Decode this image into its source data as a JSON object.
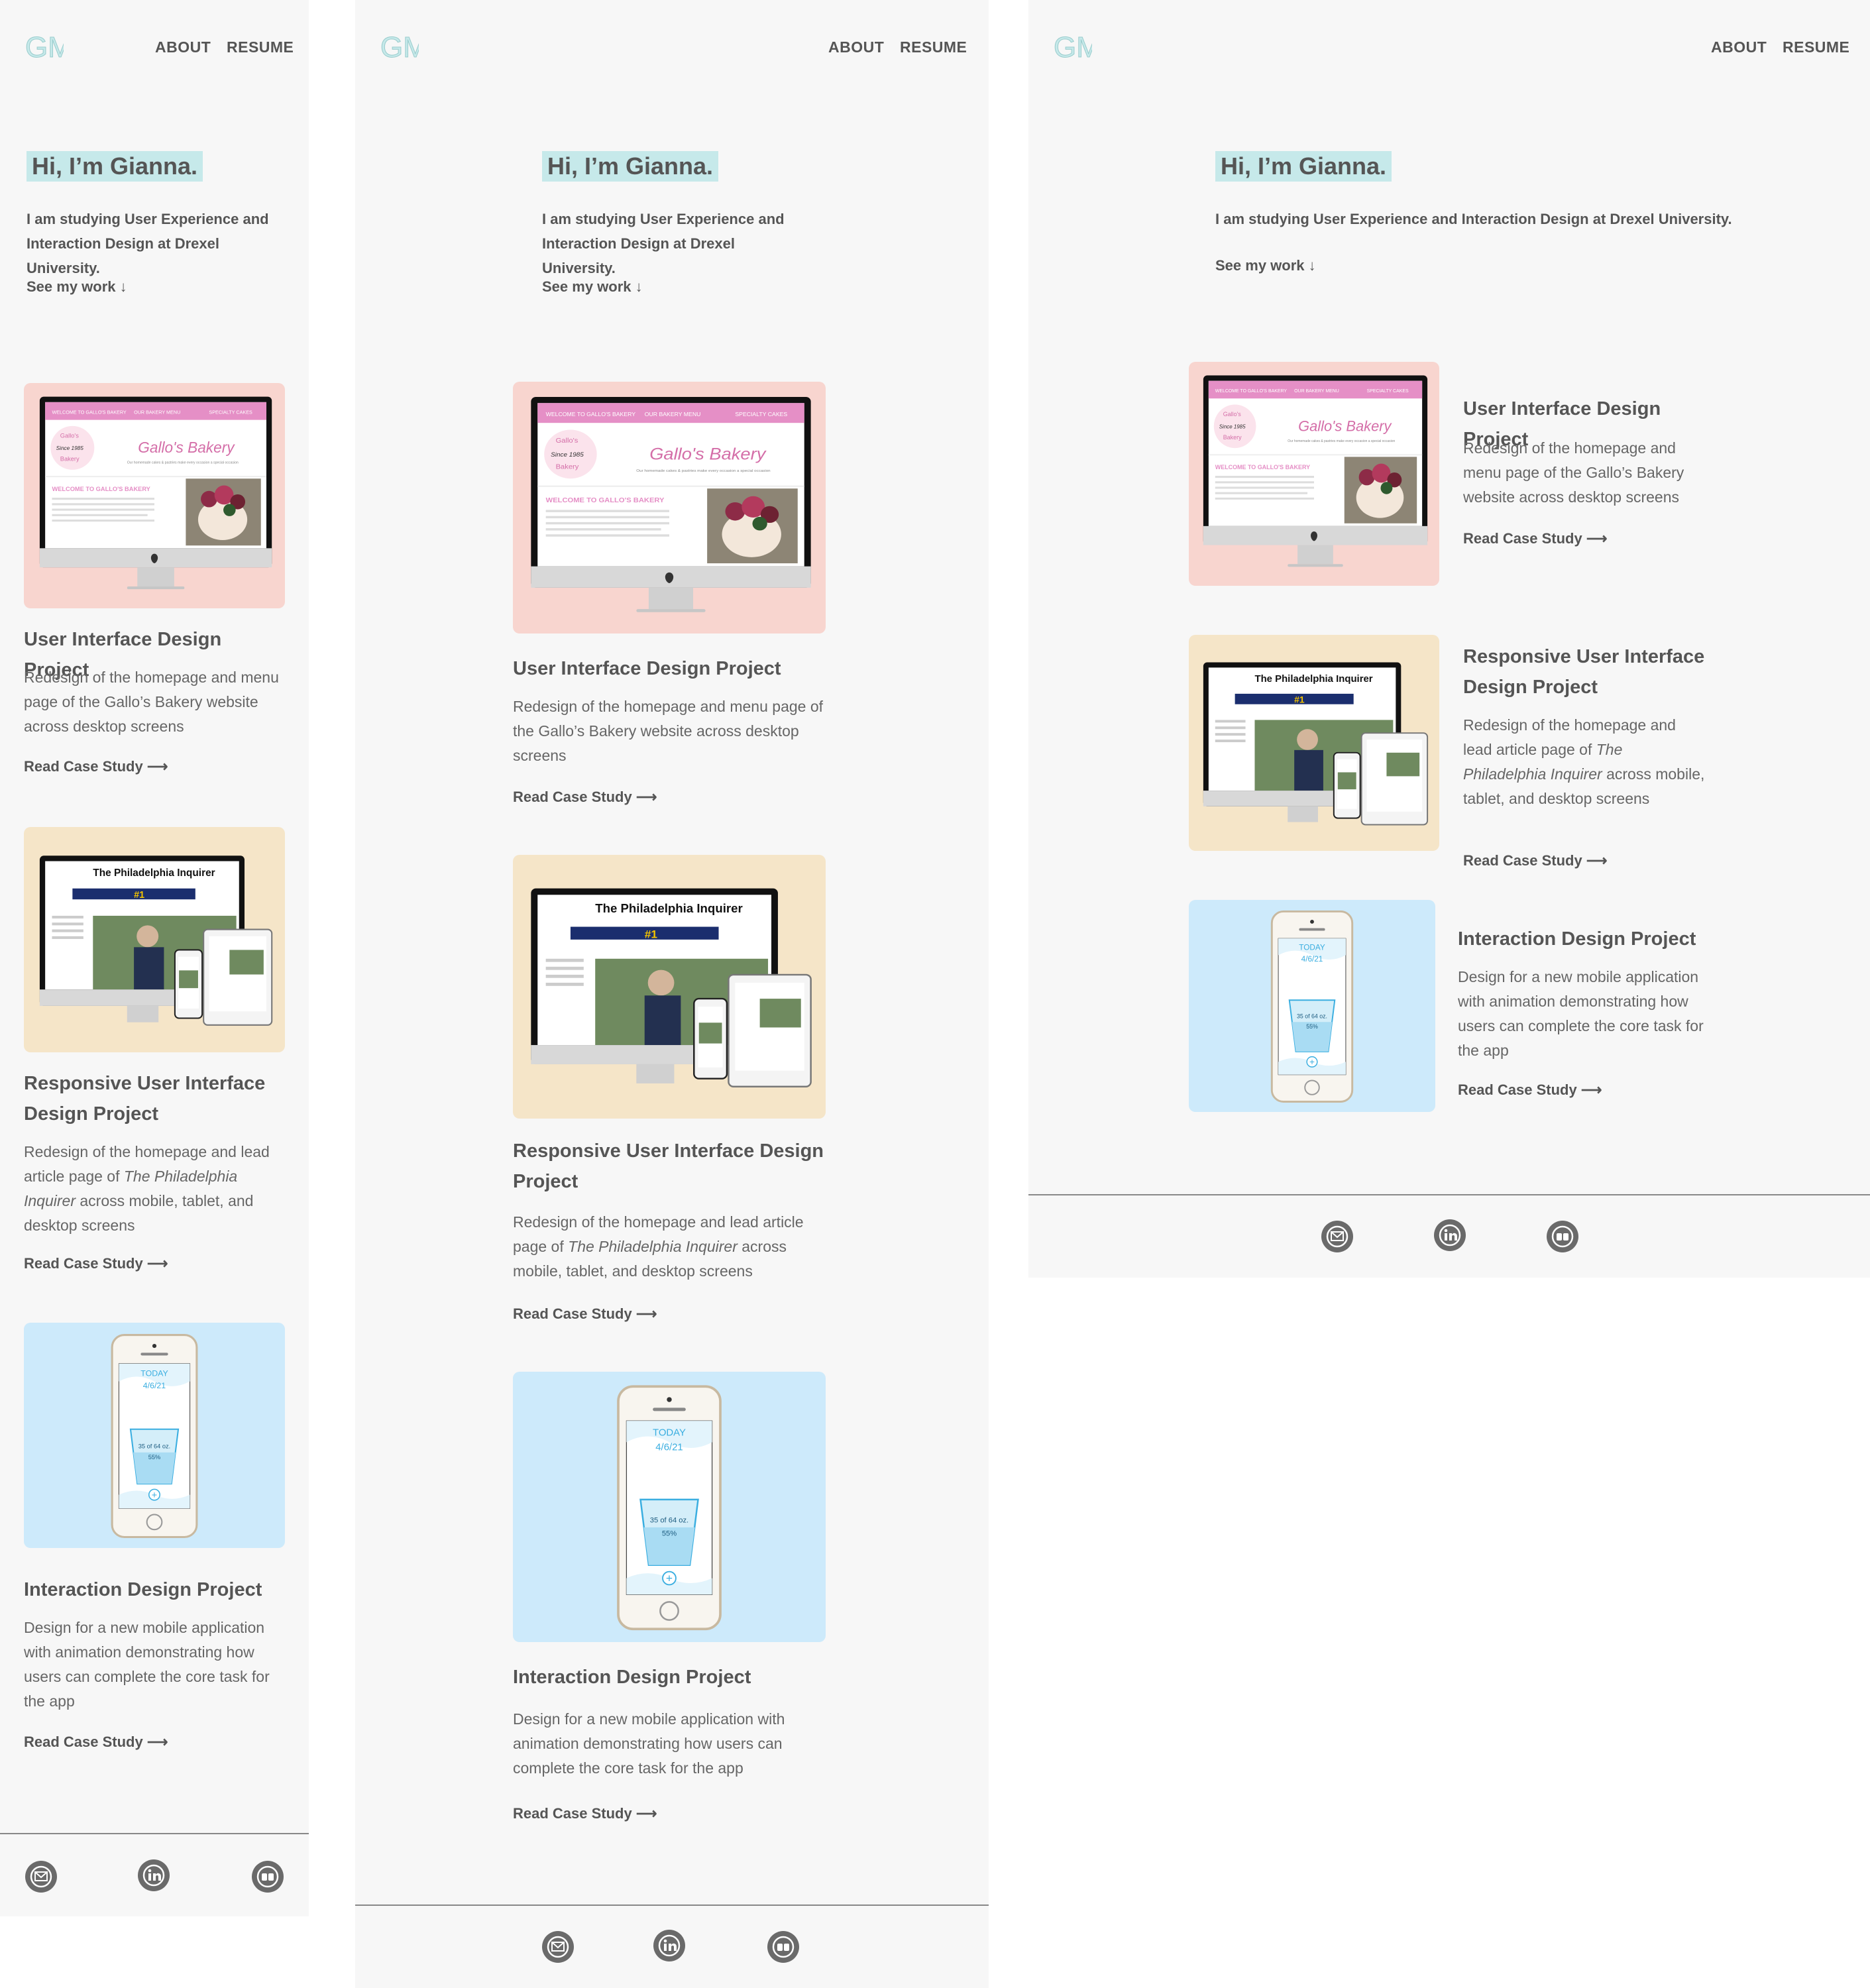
{
  "brand": {
    "logo_letters": "GM"
  },
  "nav": {
    "about": "ABOUT",
    "resume": "RESUME"
  },
  "hero": {
    "title": "Hi, I’m Gianna.",
    "intro": "I am studying User Experience and Interaction Design at Drexel University.",
    "cta": "See my work ↓"
  },
  "projects": [
    {
      "title": "User Interface Design Project",
      "desc": "Redesign of the homepage and menu page of the Gallo’s Bakery website across desktop screens",
      "link": "Read Case Study ⟶",
      "thumb_bg": "#f8d5cf",
      "screen": {
        "banner_left": "WELCOME TO GALLO'S BAKERY",
        "banner_mid": "OUR BAKERY MENU",
        "banner_right": "SPECIALTY CAKES",
        "seal_top": "Gallo's",
        "seal_mid": "Since 1985",
        "seal_bottom": "Bakery",
        "brand_script": "Gallo's Bakery",
        "tagline": "Our homemade cakes & pastries make every occasion a special occasion",
        "welcome": "WELCOME TO GALLO'S BAKERY"
      }
    },
    {
      "title": "Responsive User Interface Design Project",
      "desc_pre": "Redesign of the homepage and lead article page of ",
      "desc_em": "The Philadelphia Inquirer",
      "desc_post": " across mobile, tablet, and desktop screens",
      "link": "Read Case Study ⟶",
      "thumb_bg": "#f5e5c8",
      "screen": {
        "masthead": "The Philadelphia Inquirer",
        "badge": "#1"
      }
    },
    {
      "title": "Interaction Design Project",
      "desc": "Design for a new mobile application with animation demonstrating how users can complete the core task for the app",
      "link": "Read Case Study ⟶",
      "thumb_bg": "#cdeafb",
      "screen": {
        "today": "TODAY",
        "date": "4/6/21",
        "amount": "35 of 64 oz.",
        "percent": "55%",
        "plus": "+"
      }
    }
  ],
  "footer": {
    "icons": [
      "email-icon",
      "linkedin-icon",
      "behance-icon"
    ]
  },
  "colors": {
    "page_bg": "#f7f7f7",
    "highlight": "#c6e9ea",
    "text": "#555555",
    "bakery_pink": "#e58fc6",
    "footer_icon": "#6a6a6a"
  }
}
